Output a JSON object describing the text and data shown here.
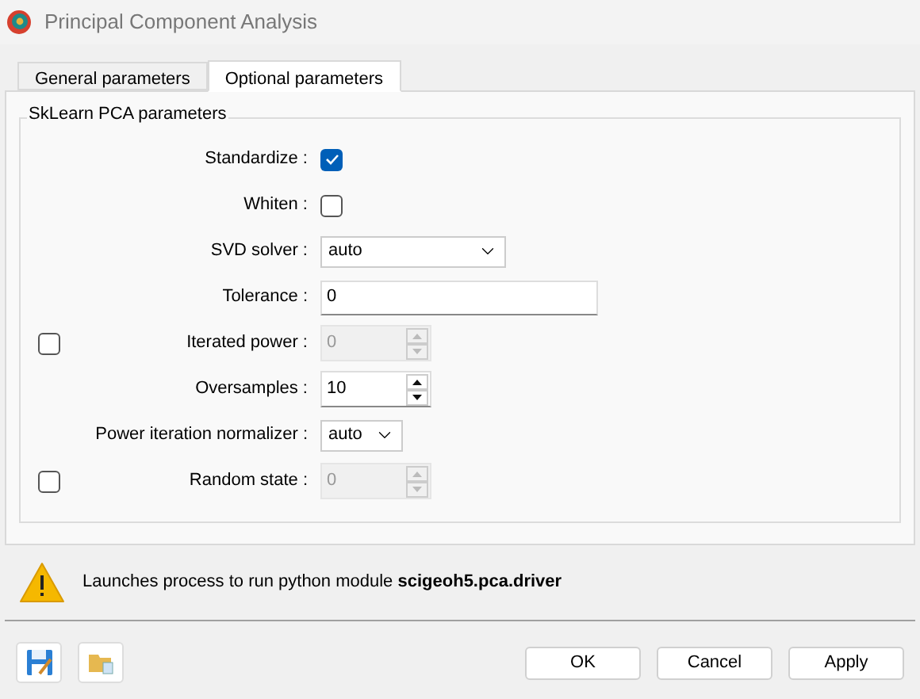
{
  "window": {
    "title": "Principal Component Analysis"
  },
  "tabs": [
    {
      "label": "General parameters",
      "selected": false
    },
    {
      "label": "Optional parameters",
      "selected": true
    }
  ],
  "group": {
    "title": "SkLearn PCA parameters"
  },
  "fields": [
    {
      "kind": "checkbox",
      "label": "Standardize :",
      "checked": true
    },
    {
      "kind": "checkbox",
      "label": "Whiten :",
      "checked": false
    },
    {
      "kind": "combo",
      "label": "SVD solver :",
      "value": "auto"
    },
    {
      "kind": "text",
      "label": "Tolerance :",
      "value": "0"
    },
    {
      "kind": "spin",
      "label": "Iterated power :",
      "value": "0",
      "disabled": true,
      "toggle": {
        "checked": false
      }
    },
    {
      "kind": "spin",
      "label": "Oversamples :",
      "value": "10",
      "disabled": false
    },
    {
      "kind": "select",
      "label": "Power iteration normalizer :",
      "value": "auto"
    },
    {
      "kind": "spin",
      "label": "Random state :",
      "value": "0",
      "disabled": true,
      "toggle": {
        "checked": false
      }
    }
  ],
  "message": {
    "text": "Launches process to run python module **scigeoh5.pca.driver**"
  },
  "buttons": [
    "OK",
    "Cancel",
    "Apply"
  ]
}
